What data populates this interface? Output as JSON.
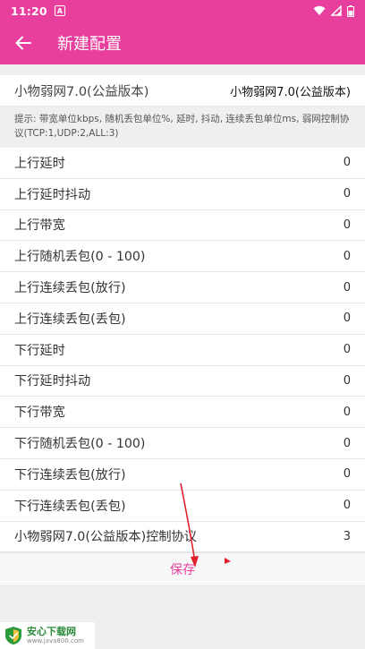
{
  "status_bar": {
    "time": "11:20",
    "notif_letter": "A",
    "icons": [
      "wifi-icon",
      "signal-icon",
      "battery-icon"
    ]
  },
  "app_bar": {
    "title": "新建配置",
    "back_icon": "arrow-left-icon"
  },
  "name_field": {
    "label": "小物弱网7.0(公益版本)",
    "value": "小物弱网7.0(公益版本)"
  },
  "hint": "提示: 带宽单位kbps, 随机丢包单位%, 延时, 抖动, 连续丢包单位ms, 弱网控制协议(TCP:1,UDP:2,ALL:3)",
  "settings": [
    {
      "label": "上行延时",
      "value": "0"
    },
    {
      "label": "上行延时抖动",
      "value": "0"
    },
    {
      "label": "上行带宽",
      "value": "0"
    },
    {
      "label": "上行随机丢包(0 - 100)",
      "value": "0"
    },
    {
      "label": "上行连续丢包(放行)",
      "value": "0"
    },
    {
      "label": "上行连续丢包(丢包)",
      "value": "0"
    },
    {
      "label": "下行延时",
      "value": "0"
    },
    {
      "label": "下行延时抖动",
      "value": "0"
    },
    {
      "label": "下行带宽",
      "value": "0"
    },
    {
      "label": "下行随机丢包(0 - 100)",
      "value": "0"
    },
    {
      "label": "下行连续丢包(放行)",
      "value": "0"
    },
    {
      "label": "下行连续丢包(丢包)",
      "value": "0"
    },
    {
      "label": "小物弱网7.0(公益版本)控制协议",
      "value": "3"
    }
  ],
  "save_label": "保存",
  "watermark": {
    "title": "安心下载网",
    "url": "www.java800.com"
  },
  "colors": {
    "accent": "#e83e9e",
    "annotation_red": "#e0202a"
  }
}
